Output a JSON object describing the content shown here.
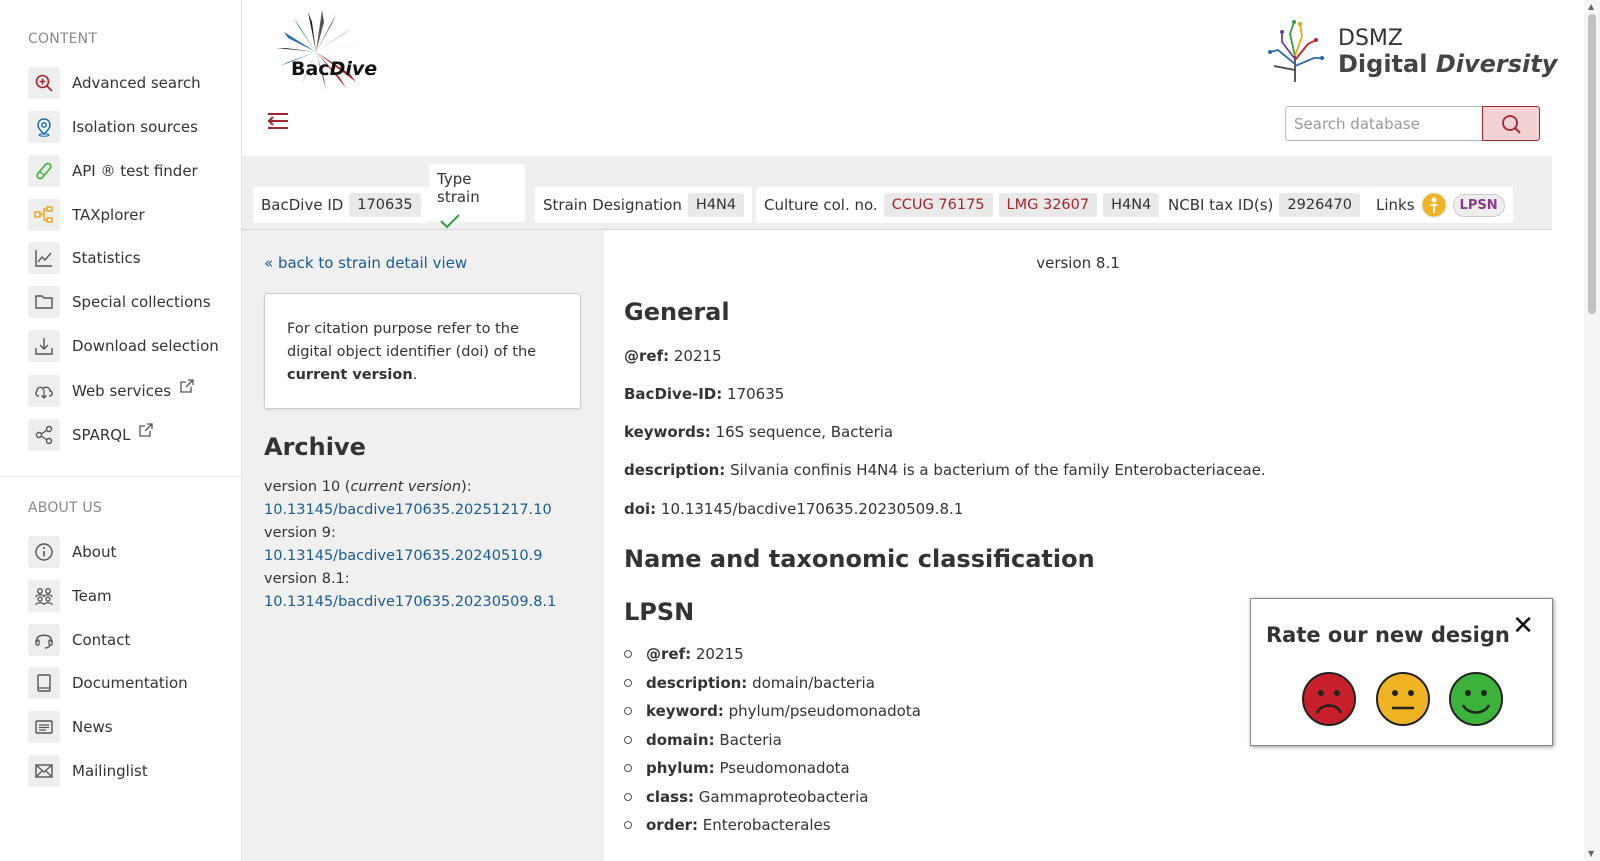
{
  "sidebar": {
    "content_heading": "CONTENT",
    "about_heading": "ABOUT US",
    "content_items": [
      {
        "label": "Advanced search",
        "icon": "search-plus-icon"
      },
      {
        "label": "Isolation sources",
        "icon": "location-pin-icon"
      },
      {
        "label": "API ® test finder",
        "icon": "test-tube-icon"
      },
      {
        "label": "TAXplorer",
        "icon": "tree-icon"
      },
      {
        "label": "Statistics",
        "icon": "line-chart-icon"
      },
      {
        "label": "Special collections",
        "icon": "folder-icon"
      },
      {
        "label": "Download selection",
        "icon": "download-icon"
      },
      {
        "label": "Web services",
        "icon": "cloud-icon"
      },
      {
        "label": "SPARQL",
        "icon": "share-nodes-icon"
      }
    ],
    "about_items": [
      {
        "label": "About",
        "icon": "info-icon"
      },
      {
        "label": "Team",
        "icon": "team-icon"
      },
      {
        "label": "Contact",
        "icon": "headset-icon"
      },
      {
        "label": "Documentation",
        "icon": "book-icon"
      },
      {
        "label": "News",
        "icon": "newspaper-icon"
      },
      {
        "label": "Mailinglist",
        "icon": "envelope-icon"
      }
    ]
  },
  "header": {
    "logo_text_1": "Bac",
    "logo_text_2": "Dive",
    "dsmz_top": "DSMZ",
    "dsmz_bottom_1": "Digital ",
    "dsmz_bottom_2": "Diversity",
    "search_placeholder": "Search database"
  },
  "infobar": {
    "bacdive_id_label": "BacDive ID",
    "bacdive_id": "170635",
    "type_strain_label": "Type strain",
    "strain_designation_label": "Strain Designation",
    "strain_designation": "H4N4",
    "culture_label": "Culture col. no.",
    "culture_1": "CCUG 76175",
    "culture_2": "LMG 32607",
    "culture_3": "H4N4",
    "ncbi_label": "NCBI tax ID(s)",
    "ncbi_id": "2926470",
    "links_label": "Links",
    "lpsn_badge": "LPSN"
  },
  "left": {
    "back_link": "« back to strain detail view",
    "citation_1": "For citation purpose refer to the digital object identifier (doi) of the ",
    "citation_bold": "current version",
    "citation_end": ".",
    "archive_title": "Archive",
    "v10_label": "version 10 (",
    "v10_current": "current version",
    "v10_end": "):",
    "v10_doi": "10.13145/bacdive170635.20251217.10",
    "v9_label": "version 9:",
    "v9_doi": "10.13145/bacdive170635.20240510.9",
    "v81_label": "version 8.1:",
    "v81_doi": "10.13145/bacdive170635.20230509.8.1"
  },
  "main": {
    "version": "version 8.1",
    "general_title": "General",
    "ref_label": "@ref:",
    "ref_value": "20215",
    "id_label": "BacDive-ID:",
    "id_value": "170635",
    "keywords_label": "keywords:",
    "keywords_value": "16S sequence, Bacteria",
    "description_label": "description:",
    "description_value": "Silvania confinis H4N4 is a bacterium of the family Enterobacteriaceae.",
    "doi_label": "doi:",
    "doi_value": "10.13145/bacdive170635.20230509.8.1",
    "taxonomy_title": "Name and taxonomic classification",
    "lpsn_title": "LPSN",
    "lpsn_items": [
      {
        "label": "@ref:",
        "value": "20215"
      },
      {
        "label": "description:",
        "value": "domain/bacteria"
      },
      {
        "label": "keyword:",
        "value": "phylum/pseudomonadota"
      },
      {
        "label": "domain:",
        "value": "Bacteria"
      },
      {
        "label": "phylum:",
        "value": "Pseudomonadota"
      },
      {
        "label": "class:",
        "value": "Gammaproteobacteria"
      },
      {
        "label": "order:",
        "value": "Enterobacterales"
      }
    ]
  },
  "rating": {
    "title": "Rate our new design",
    "close": "✕"
  },
  "colors": {
    "brand_red": "#a4262c",
    "link_blue": "#1a5a96",
    "face_red": "#c8202a",
    "face_yellow": "#f0b323",
    "face_green": "#3cb43c"
  }
}
